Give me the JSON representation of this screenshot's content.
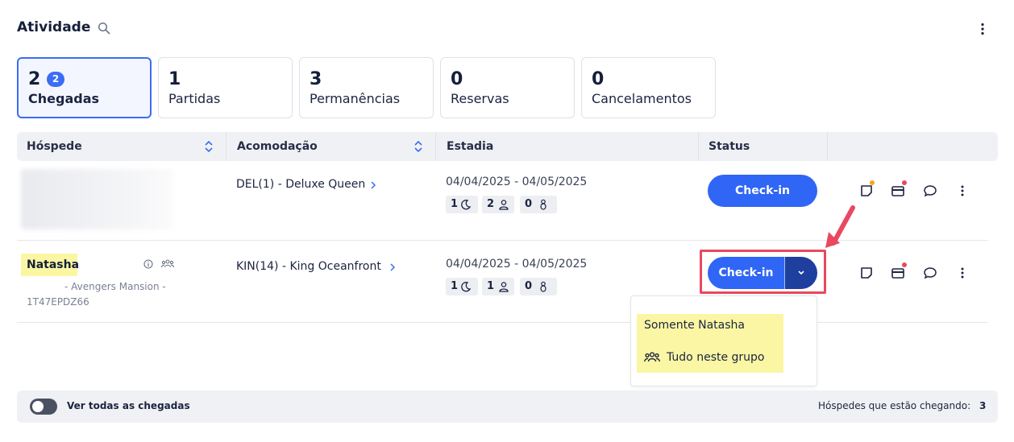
{
  "header": {
    "title": "Atividade"
  },
  "cards": [
    {
      "count": "2",
      "label": "Chegadas",
      "badge": "2"
    },
    {
      "count": "1",
      "label": "Partidas"
    },
    {
      "count": "3",
      "label": "Permanências"
    },
    {
      "count": "0",
      "label": "Reservas"
    },
    {
      "count": "0",
      "label": "Cancelamentos"
    }
  ],
  "table": {
    "columns": [
      "Hóspede",
      "Acomodação",
      "Estadia",
      "Status"
    ],
    "rows": [
      {
        "guest": "",
        "accommodation": "DEL(1) - Deluxe Queen",
        "dates": "04/04/2025 - 04/05/2025",
        "nights": "1",
        "adults": "2",
        "children": "0",
        "status_button": "Check-in",
        "note_dot_color": "#f5a623",
        "card_dot_color": "#e9485e"
      },
      {
        "guest": "Natasha",
        "group": "- Avengers Mansion -",
        "code": "1T47EPDZ66",
        "accommodation": "KIN(14) - King Oceanfront",
        "dates": "04/04/2025 - 04/05/2025",
        "nights": "1",
        "adults": "1",
        "children": "0",
        "status_button": "Check-in",
        "card_dot_color": "#e9485e"
      }
    ]
  },
  "dropdown": {
    "items": [
      "Somente Natasha",
      "Tudo neste grupo"
    ]
  },
  "footer": {
    "toggle_label": "Ver todas as chegadas",
    "toggle_on": false,
    "summary_label": "Hóspedes que estão chegando:",
    "summary_count": "3"
  },
  "colors": {
    "accent": "#2f66f5",
    "annotation": "#e9485e",
    "highlight": "#fbf6a3"
  }
}
